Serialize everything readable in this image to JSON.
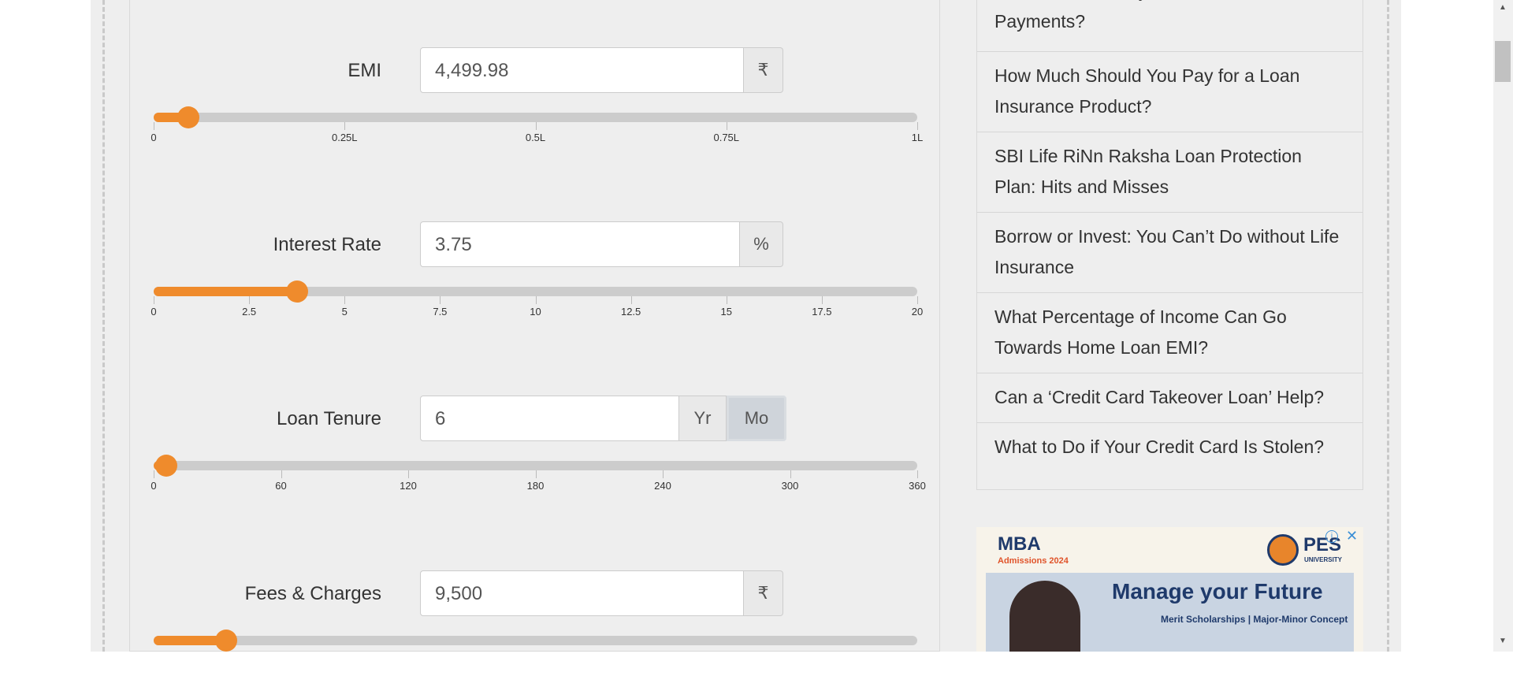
{
  "calculator": {
    "emi": {
      "label": "EMI",
      "value": "4,499.98",
      "unit": "₹",
      "slider": {
        "position": 0.045,
        "ticks": [
          "0",
          "0.25L",
          "0.5L",
          "0.75L",
          "1L"
        ]
      }
    },
    "interest_rate": {
      "label": "Interest Rate",
      "value": "3.75",
      "unit": "%",
      "slider": {
        "position": 0.1875,
        "ticks": [
          "0",
          "2.5",
          "5",
          "7.5",
          "10",
          "12.5",
          "15",
          "17.5",
          "20"
        ]
      }
    },
    "loan_tenure": {
      "label": "Loan Tenure",
      "value": "6",
      "unit_year": "Yr",
      "unit_month": "Mo",
      "selected_unit": "Mo",
      "slider": {
        "position": 0.0167,
        "ticks": [
          "0",
          "60",
          "120",
          "180",
          "240",
          "300",
          "360"
        ]
      }
    },
    "fees_charges": {
      "label": "Fees & Charges",
      "value": "9,500",
      "unit": "₹",
      "slider": {
        "position": 0.095
      }
    }
  },
  "sidebar": {
    "articles": [
      "How to Use RuPay Credit Card for UPI Payments?",
      "How Much Should You Pay for a Loan Insurance Product?",
      "SBI Life RiNn Raksha Loan Protection Plan: Hits and Misses",
      "Borrow or Invest: You Can’t Do without Life Insurance",
      "What Percentage of Income Can Go Towards Home Loan EMI?",
      "Can a ‘Credit Card Takeover Loan’ Help?",
      "What to Do if Your Credit Card Is Stolen?"
    ]
  },
  "ad": {
    "title": "MBA",
    "subtitle": "Admissions 2024",
    "brand": "PES",
    "brand_sub": "UNIVERSITY",
    "headline": "Manage your Future",
    "tagline": "Merit Scholarships | Major-Minor Concept"
  },
  "colors": {
    "accent": "#ef8b2c",
    "track": "#cccccc"
  }
}
